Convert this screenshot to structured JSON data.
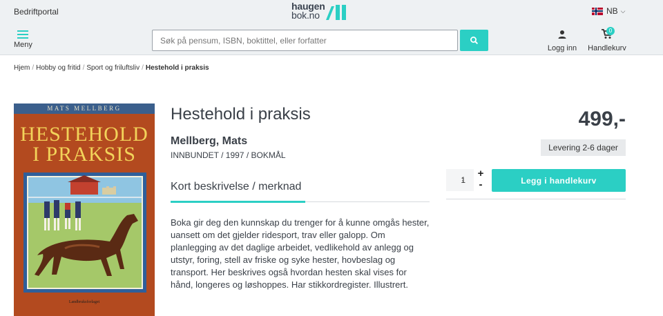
{
  "header": {
    "corporate_link": "Bedriftportal",
    "logo_line1": "haugen",
    "logo_line2": "bok.no",
    "language": "NB",
    "menu_label": "Meny",
    "search_placeholder": "Søk på pensum, ISBN, boktittel, eller forfatter",
    "login_label": "Logg inn",
    "cart_label": "Handlekurv",
    "cart_count": "0"
  },
  "breadcrumb": {
    "items": [
      "Hjem",
      "Hobby og fritid",
      "Sport og friluftsliv"
    ],
    "current": "Hestehold i praksis"
  },
  "cover": {
    "author": "MATS MELLBERG",
    "title_line1": "HESTEHOLD",
    "title_line2": "I PRAKSIS",
    "publisher": "Landbruksforlaget"
  },
  "product": {
    "title": "Hestehold i praksis",
    "author": "Mellberg, Mats",
    "meta": "INNBUNDET / 1997 / BOKMÅL",
    "tab_label": "Kort beskrivelse / merknad",
    "description": "Boka gir deg den kunnskap du trenger for å kunne omgås hester, uansett om det gjelder ridesport, trav eller galopp. Om planlegging av det daglige arbeidet, vedlikehold av anlegg og utstyr, foring, stell av friske og syke hester, hovbeslag og transport. Her beskrives også hvordan hesten skal vises for hånd, longeres og løshoppes. Har stikkordregister. Illustrert."
  },
  "purchase": {
    "price": "499,-",
    "delivery": "Levering 2-6 dager",
    "quantity": "1",
    "plus": "+",
    "minus": "-",
    "add_to_cart": "Legg i handlekurv"
  },
  "colors": {
    "accent": "#2bcfc4",
    "topbar_bg": "#eef1f3",
    "text": "#3a4048"
  }
}
